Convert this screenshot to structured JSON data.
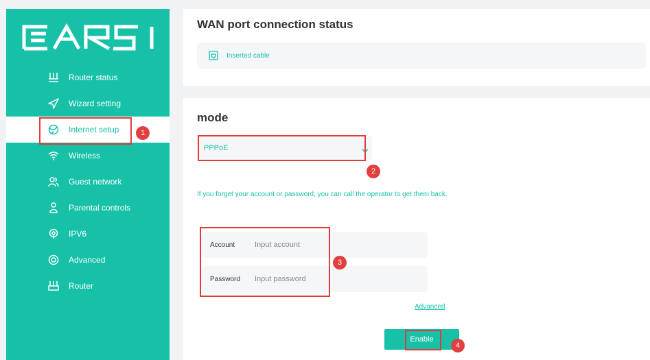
{
  "sidebar": {
    "logo": "CARES",
    "items": [
      {
        "label": "Router status",
        "icon": "router-status-icon"
      },
      {
        "label": "Wizard setting",
        "icon": "paper-plane-icon"
      },
      {
        "label": "Internet setup",
        "icon": "globe-icon",
        "active": true
      },
      {
        "label": "Wireless",
        "icon": "wifi-icon"
      },
      {
        "label": "Guest network",
        "icon": "guests-icon"
      },
      {
        "label": "Parental controls",
        "icon": "parent-child-icon"
      },
      {
        "label": "IPV6",
        "icon": "ipv6-icon"
      },
      {
        "label": "Advanced",
        "icon": "target-icon"
      },
      {
        "label": "Router",
        "icon": "router-icon"
      }
    ]
  },
  "wan": {
    "title": "WAN port connection status",
    "status": "Inserted cable",
    "status_icon": "cable-icon"
  },
  "mode": {
    "title": "mode",
    "selected": "PPPoE",
    "hint": "If you forget your account or password, you can call the operator to get them back.",
    "account_label": "Account",
    "account_placeholder": "Input account",
    "password_label": "Password",
    "password_placeholder": "Input password",
    "advanced_link": "Advanced",
    "enable_button": "Enable"
  },
  "annotations": [
    "1",
    "2",
    "3",
    "4"
  ],
  "colors": {
    "accent": "#16c1a8",
    "marker": "#e24040"
  }
}
